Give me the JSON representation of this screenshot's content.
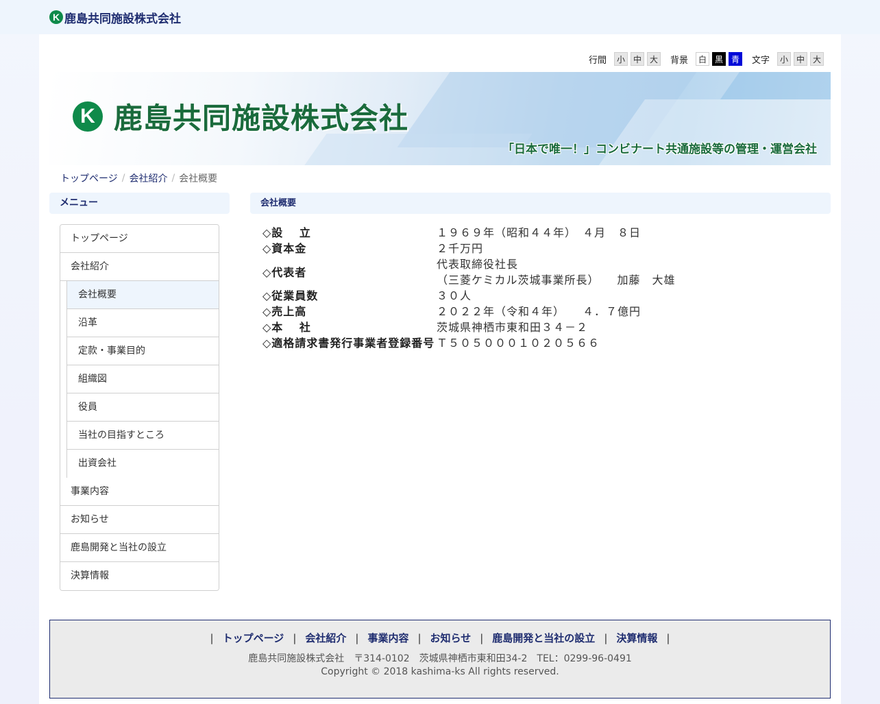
{
  "header": {
    "site_name": "鹿島共同施設株式会社",
    "logo_letter": "K"
  },
  "tools": {
    "line_spacing": {
      "label": "行間",
      "options": [
        "小",
        "中",
        "大"
      ]
    },
    "background": {
      "label": "背景",
      "options": [
        "白",
        "黒",
        "青"
      ],
      "colors": [
        "#ffffff",
        "#000000",
        "#0009d8"
      ]
    },
    "text_size": {
      "label": "文字",
      "options": [
        "小",
        "中",
        "大"
      ]
    }
  },
  "banner": {
    "logo_letter": "K",
    "title": "鹿島共同施設株式会社",
    "tagline": "「日本で唯一！」コンビナート共通施設等の管理・運営会社"
  },
  "breadcrumb": {
    "home": "トップページ",
    "section": "会社紹介",
    "current": "会社概要",
    "sep": "/"
  },
  "sidebar": {
    "heading": "メニュー",
    "items": [
      {
        "label": "トップページ"
      },
      {
        "label": "会社紹介",
        "chevron": ""
      },
      {
        "label": "事業内容",
        "chevron": ""
      },
      {
        "label": "お知らせ"
      },
      {
        "label": "鹿島開発と当社の設立",
        "chevron": ""
      },
      {
        "label": "決算情報"
      }
    ],
    "submenu": [
      {
        "label": "会社概要"
      },
      {
        "label": "沿革"
      },
      {
        "label": "定款・事業目的"
      },
      {
        "label": "組織図"
      },
      {
        "label": "役員"
      },
      {
        "label": "当社の目指すところ"
      },
      {
        "label": "出資会社"
      }
    ]
  },
  "main": {
    "heading": "会社概要",
    "rows": [
      {
        "label": "◇設　 立",
        "value": "１９６９年（昭和４４年）　４月　８日"
      },
      {
        "label": "◇資本金",
        "value": "２千万円"
      },
      {
        "label": "◇代表者",
        "value": "代表取締役社長",
        "value2": "（三菱ケミカル茨城事業所長）　　加藤　大雄"
      },
      {
        "label": "◇従業員数",
        "value": "３０人"
      },
      {
        "label": "◇売上高",
        "value": "２０２２年（令和４年）　　４．７億円"
      },
      {
        "label": "◇本　 社",
        "value": "茨城県神栖市東和田３４－２"
      },
      {
        "label": "◇適格請求書発行事業者登録番号",
        "value": "Ｔ５０５０００１０２０５６６"
      }
    ]
  },
  "footer": {
    "separator": "|",
    "nav": [
      "トップページ",
      "会社紹介",
      "事業内容",
      "お知らせ",
      "鹿島開発と当社の設立",
      "決算情報"
    ],
    "address": "鹿島共同施設株式会社　〒314-0102　茨城県神栖市東和田34-2　TEL：0299-96-0491",
    "copyright": "Copyright © 2018 kashima-ks All rights reserved."
  }
}
